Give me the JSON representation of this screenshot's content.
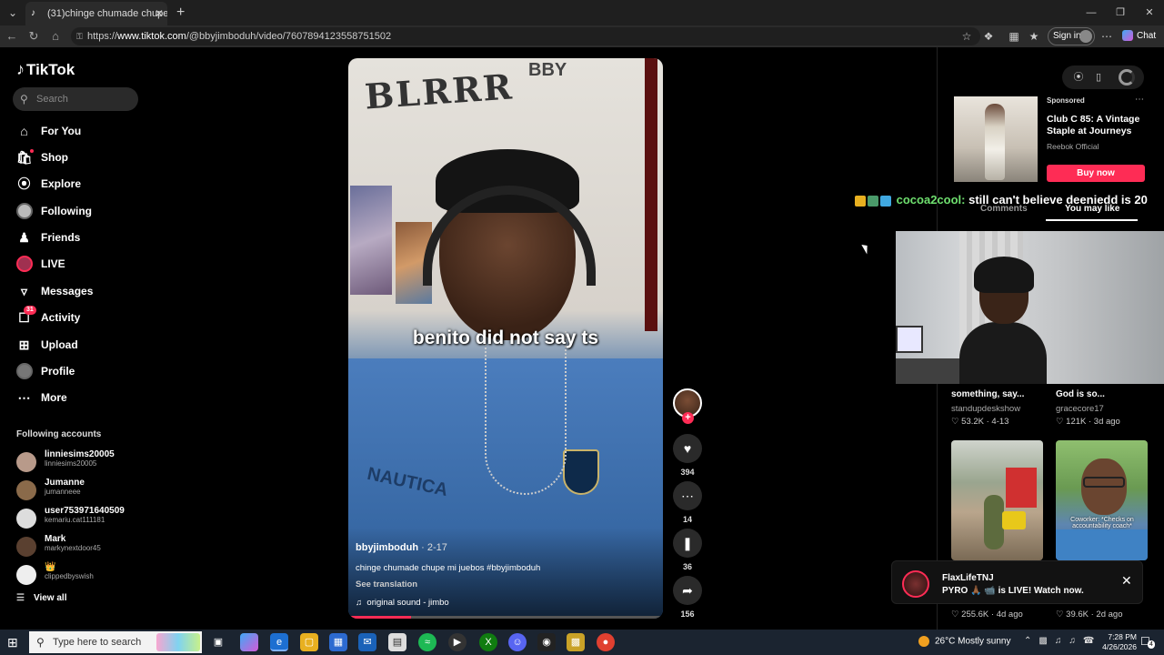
{
  "browser": {
    "tab_title": "(31)chinge chumade chupe m",
    "url_prefix": "https://",
    "url_host": "www.tiktok.com",
    "url_path": "/@bbyjimboduh/video/7607894123558751502",
    "signin_label": "Sign in",
    "chat_label": "Chat",
    "icons": [
      "back-icon",
      "refresh-icon",
      "home-icon",
      "favorite-star-icon",
      "extensions-icon",
      "collections-icon",
      "more-icon"
    ]
  },
  "sidebar": {
    "logo": "TikTok",
    "search_placeholder": "Search",
    "nav": [
      {
        "label": "For You",
        "icon": "home-icon"
      },
      {
        "label": "Shop",
        "icon": "shop-icon"
      },
      {
        "label": "Explore",
        "icon": "compass-icon"
      },
      {
        "label": "Following",
        "icon": "avatar"
      },
      {
        "label": "Friends",
        "icon": "friends-icon"
      },
      {
        "label": "LIVE",
        "icon": "live-icon"
      },
      {
        "label": "Messages",
        "icon": "messages-icon"
      },
      {
        "label": "Activity",
        "icon": "activity-icon",
        "badge": "31"
      },
      {
        "label": "Upload",
        "icon": "upload-icon"
      },
      {
        "label": "Profile",
        "icon": "avatar"
      },
      {
        "label": "More",
        "icon": "more-dots-icon"
      }
    ],
    "following_title": "Following accounts",
    "accounts": [
      {
        "name": "linniesims20005",
        "handle": "linniesims20005"
      },
      {
        "name": "Jumanne",
        "handle": "jumanneee"
      },
      {
        "name": "user753971640509",
        "handle": "kemariu.cat111181"
      },
      {
        "name": "Mark",
        "handle": "markynextdoor45"
      },
      {
        "name": "👑",
        "handle": "clippedbyswish"
      }
    ],
    "view_all": "View all"
  },
  "video": {
    "wall_text": "BLRRR",
    "wall_text2": "BBY",
    "shirt_text": "NAUTICA",
    "caption": "benito did not say ts",
    "username": "bbyjimboduh",
    "date": " · 2-17",
    "description": "chinge chumade chupe mi juebos #bbyjimboduh",
    "see_translation": "See translation",
    "sound": "original sound - jimbo",
    "progress": 0.2
  },
  "actions": {
    "likes": "394",
    "comments": "14",
    "saves": "36",
    "shares": "156"
  },
  "ad": {
    "sponsored": "Sponsored",
    "title": "Club C 85: A Vintage Staple at Journeys",
    "brand": "Reebok Official",
    "cta": "Buy now"
  },
  "overlay_chat": {
    "user": "cocoa2cool:",
    "message": "still can't believe deeniedd is 20"
  },
  "right_tabs": {
    "comments": "Comments",
    "you_may_like": "You may like"
  },
  "cards": [
    {
      "title": "something, say...",
      "author": "standupdeskshow",
      "likes": "♡ 53.2K",
      "date": " · 4-13"
    },
    {
      "title": "God is so...",
      "author": "gracecore17",
      "likes": "♡ 121K",
      "date": " · 3d ago"
    }
  ],
  "thumb2_caption": "Coworker: *Checks on accountability coach*",
  "notification": {
    "name": "FlaxLifeTNJ",
    "message": "PYRO 🙏🏾 📹 is LIVE! Watch now."
  },
  "bottom_meta": [
    {
      "likes": "♡ 255.6K",
      "date": " · 4d ago"
    },
    {
      "likes": "♡ 39.6K",
      "date": " · 2d ago"
    }
  ],
  "taskbar": {
    "search_placeholder": "Type here to search",
    "weather": "26°C  Mostly sunny",
    "time": "7:28 PM",
    "date": "4/26/2026",
    "notification_count": "4"
  },
  "colors": {
    "accent": "#fe2c55",
    "background": "#000000",
    "buy_button": "#fe2c55"
  }
}
